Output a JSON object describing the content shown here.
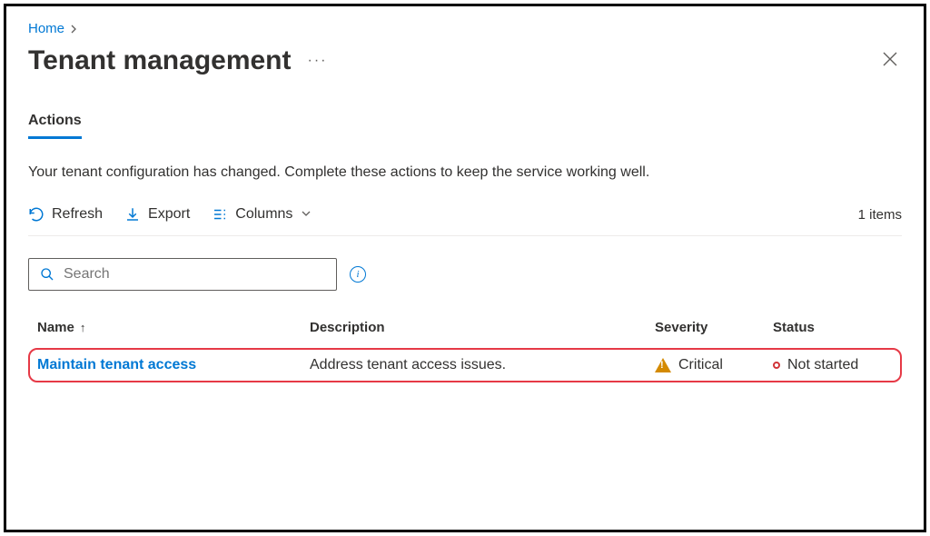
{
  "breadcrumb": {
    "home": "Home"
  },
  "page": {
    "title": "Tenant management"
  },
  "tabs": {
    "actions": "Actions"
  },
  "message": "Your tenant configuration has changed. Complete these actions to keep the service working well.",
  "toolbar": {
    "refresh": "Refresh",
    "export": "Export",
    "columns": "Columns",
    "item_count": "1 items"
  },
  "search": {
    "placeholder": "Search"
  },
  "table": {
    "headers": {
      "name": "Name",
      "description": "Description",
      "severity": "Severity",
      "status": "Status"
    },
    "rows": [
      {
        "name": "Maintain tenant access",
        "description": "Address tenant access issues.",
        "severity": "Critical",
        "status": "Not started"
      }
    ]
  }
}
